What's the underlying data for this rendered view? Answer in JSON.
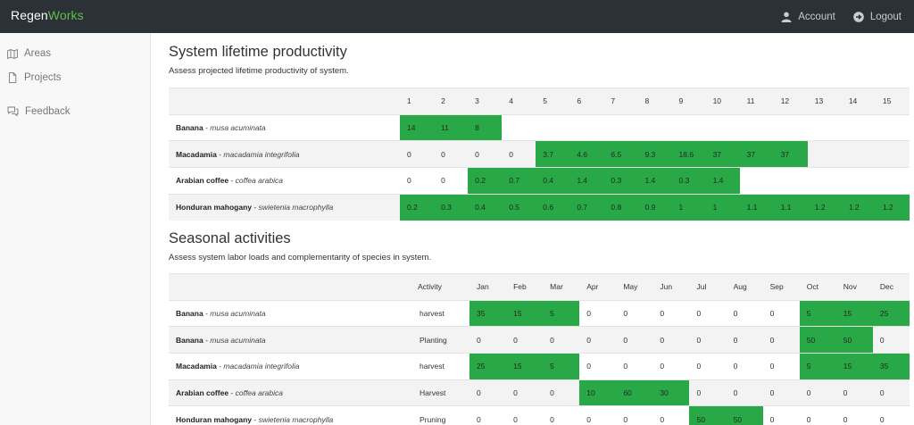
{
  "brand": {
    "part1": "Regen",
    "part2": "Works"
  },
  "nav": {
    "account": "Account",
    "logout": "Logout"
  },
  "sidebar": {
    "areas": "Areas",
    "projects": "Projects",
    "feedback": "Feedback"
  },
  "colors": {
    "highlight": "#29a847",
    "topbar": "#2c3137",
    "brand_accent": "#5fbe4d"
  },
  "productivity": {
    "title": "System lifetime productivity",
    "subtitle": "Assess projected lifetime productivity of system.",
    "years": [
      "1",
      "2",
      "3",
      "4",
      "5",
      "6",
      "7",
      "8",
      "9",
      "10",
      "11",
      "12",
      "13",
      "14",
      "15"
    ],
    "rows": [
      {
        "name": "Banana",
        "sci": "musa acuminata",
        "cells": [
          "14",
          "11",
          "8",
          "",
          "",
          "",
          "",
          "",
          "",
          "",
          "",
          "",
          "",
          "",
          ""
        ],
        "hi": [
          true,
          true,
          true,
          false,
          false,
          false,
          false,
          false,
          false,
          false,
          false,
          false,
          false,
          false,
          false
        ]
      },
      {
        "name": "Macadamia",
        "sci": "macadamia integrifolia",
        "cells": [
          "0",
          "0",
          "0",
          "0",
          "3.7",
          "4.6",
          "6.5",
          "9.3",
          "18.6",
          "37",
          "37",
          "37",
          "",
          "",
          ""
        ],
        "hi": [
          false,
          false,
          false,
          false,
          true,
          true,
          true,
          true,
          true,
          true,
          true,
          true,
          false,
          false,
          false
        ]
      },
      {
        "name": "Arabian coffee",
        "sci": "coffea arabica",
        "cells": [
          "0",
          "0",
          "0.2",
          "0.7",
          "0.4",
          "1.4",
          "0.3",
          "1.4",
          "0.3",
          "1.4",
          "",
          "",
          "",
          "",
          ""
        ],
        "hi": [
          false,
          false,
          true,
          true,
          true,
          true,
          true,
          true,
          true,
          true,
          false,
          false,
          false,
          false,
          false
        ]
      },
      {
        "name": "Honduran mahogany",
        "sci": "swietenia macrophylla",
        "cells": [
          "0.2",
          "0.3",
          "0.4",
          "0.5",
          "0.6",
          "0.7",
          "0.8",
          "0.9",
          "1",
          "1",
          "1.1",
          "1.1",
          "1.2",
          "1.2",
          "1.2"
        ],
        "hi": [
          true,
          true,
          true,
          true,
          true,
          true,
          true,
          true,
          true,
          true,
          true,
          true,
          true,
          true,
          true
        ]
      }
    ]
  },
  "seasonal": {
    "title": "Seasonal activities",
    "subtitle": "Assess system labor loads and complementarity of species in system.",
    "activity_header": "Activity",
    "months": [
      "Jan",
      "Feb",
      "Mar",
      "Apr",
      "May",
      "Jun",
      "Jul",
      "Aug",
      "Sep",
      "Oct",
      "Nov",
      "Dec"
    ],
    "rows": [
      {
        "name": "Banana",
        "sci": "musa acuminata",
        "activity": "harvest",
        "cells": [
          "35",
          "15",
          "5",
          "0",
          "0",
          "0",
          "0",
          "0",
          "0",
          "5",
          "15",
          "25"
        ],
        "hi": [
          true,
          true,
          true,
          false,
          false,
          false,
          false,
          false,
          false,
          true,
          true,
          true
        ]
      },
      {
        "name": "Banana",
        "sci": "musa acuminata",
        "activity": "Planting",
        "cells": [
          "0",
          "0",
          "0",
          "0",
          "0",
          "0",
          "0",
          "0",
          "0",
          "50",
          "50",
          "0"
        ],
        "hi": [
          false,
          false,
          false,
          false,
          false,
          false,
          false,
          false,
          false,
          true,
          true,
          false
        ]
      },
      {
        "name": "Macadamia",
        "sci": "macadamia integrifolia",
        "activity": "harvest",
        "cells": [
          "25",
          "15",
          "5",
          "0",
          "0",
          "0",
          "0",
          "0",
          "0",
          "5",
          "15",
          "35"
        ],
        "hi": [
          true,
          true,
          true,
          false,
          false,
          false,
          false,
          false,
          false,
          true,
          true,
          true
        ]
      },
      {
        "name": "Arabian coffee",
        "sci": "coffea arabica",
        "activity": "Harvest",
        "cells": [
          "0",
          "0",
          "0",
          "10",
          "60",
          "30",
          "0",
          "0",
          "0",
          "0",
          "0",
          "0"
        ],
        "hi": [
          false,
          false,
          false,
          true,
          true,
          true,
          false,
          false,
          false,
          false,
          false,
          false
        ]
      },
      {
        "name": "Honduran mahogany",
        "sci": "swietenia macrophylla",
        "activity": "Pruning",
        "cells": [
          "0",
          "0",
          "0",
          "0",
          "0",
          "0",
          "50",
          "50",
          "0",
          "0",
          "0",
          "0"
        ],
        "hi": [
          false,
          false,
          false,
          false,
          false,
          false,
          true,
          true,
          false,
          false,
          false,
          false
        ]
      }
    ]
  }
}
